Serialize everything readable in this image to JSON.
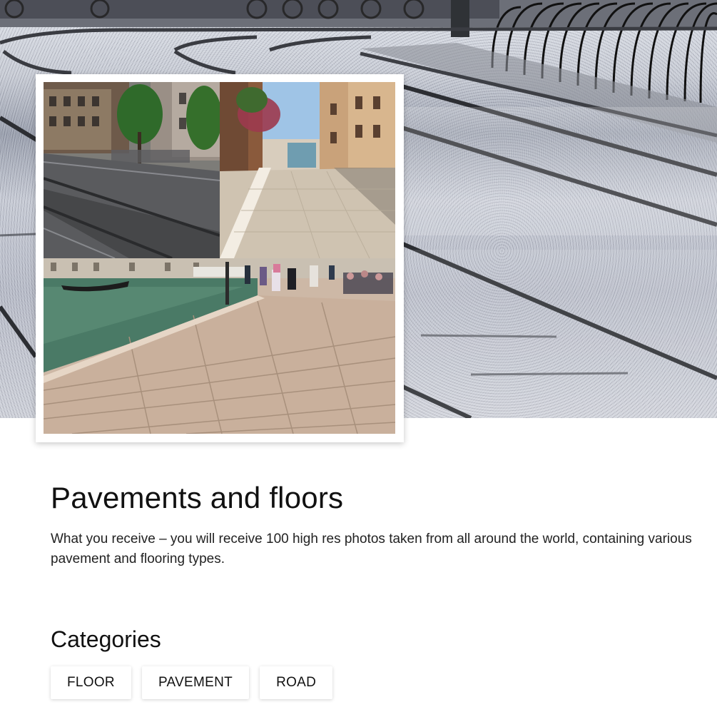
{
  "hero": {
    "image_subject": "Tram tracks on a sunlit street"
  },
  "collage": {
    "tiles": [
      "Street with tram tracks and trees",
      "Stone paved canal walkway",
      "Brick pavement along canal with pedestrians"
    ]
  },
  "content": {
    "title": "Pavements and floors",
    "description": "What you receive – you will receive 100 high res photos taken from all around the world, containing various pavement and flooring types."
  },
  "categories": {
    "heading": "Categories",
    "items": [
      {
        "label": "FLOOR"
      },
      {
        "label": "PAVEMENT"
      },
      {
        "label": "ROAD"
      }
    ]
  }
}
